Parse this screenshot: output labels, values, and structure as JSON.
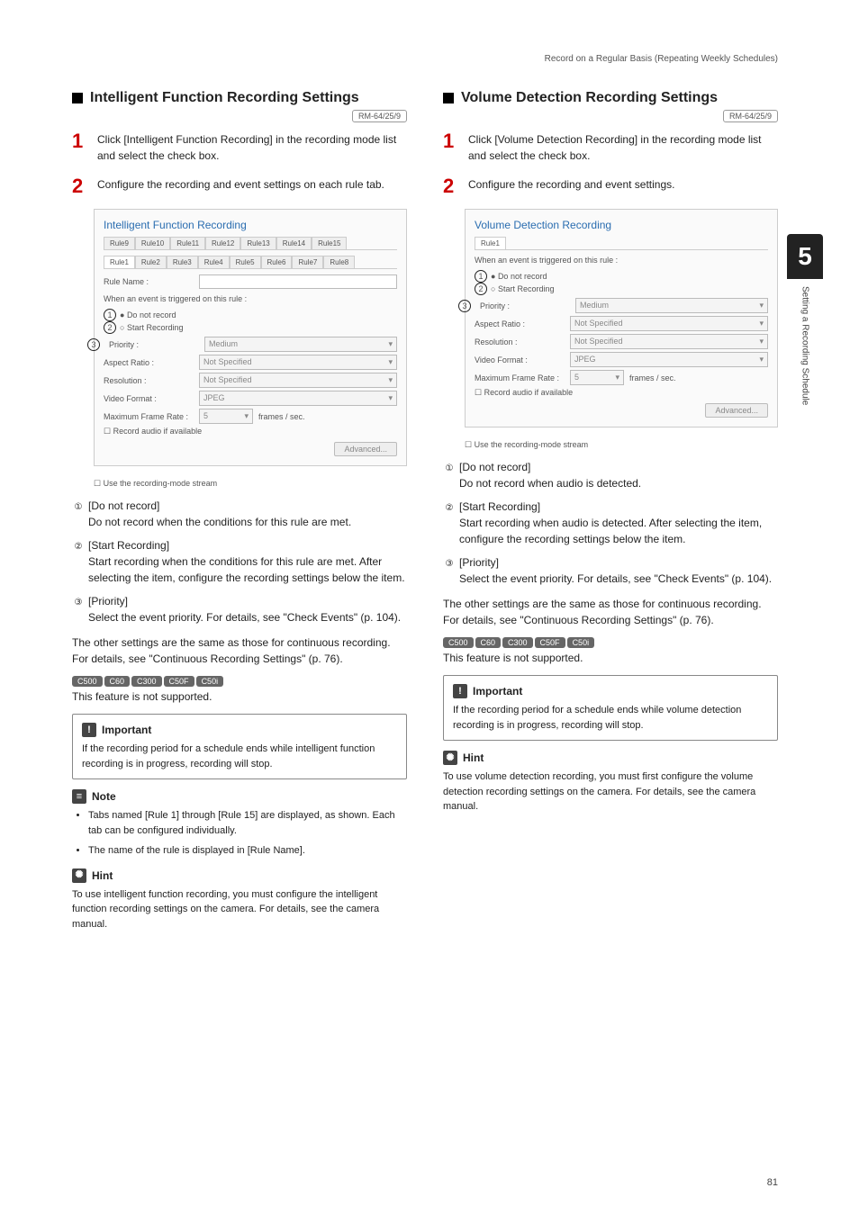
{
  "header": {
    "breadcrumb": "Record on a Regular Basis (Repeating Weekly Schedules)"
  },
  "side": {
    "chapter_num": "5",
    "chapter_title": "Setting a Recording Schedule"
  },
  "left": {
    "heading": "Intelligent Function Recording Settings",
    "badge": "RM-64/25/9",
    "step1": "Click [Intelligent Function Recording] in the recording mode list and select the check box.",
    "step2": "Configure the recording and event settings on each rule tab.",
    "shot": {
      "title": "Intelligent Function Recording",
      "tabs_top": [
        "Rule9",
        "Rule10",
        "Rule11",
        "Rule12",
        "Rule13",
        "Rule14",
        "Rule15"
      ],
      "tabs_bottom": [
        "Rule1",
        "Rule2",
        "Rule3",
        "Rule4",
        "Rule5",
        "Rule6",
        "Rule7",
        "Rule8"
      ],
      "rule_name_label": "Rule Name :",
      "trigger_label": "When an event is triggered on this rule :",
      "opt1": "Do not record",
      "opt2": "Start Recording",
      "priority_label": "Priority :",
      "priority_val": "Medium",
      "aspect_label": "Aspect Ratio :",
      "aspect_val": "Not Specified",
      "res_label": "Resolution :",
      "res_val": "Not Specified",
      "vf_label": "Video Format :",
      "vf_val": "JPEG",
      "mfr_label": "Maximum Frame Rate :",
      "mfr_val": "5",
      "mfr_unit": "frames / sec.",
      "audio_check": "Record audio if available",
      "advanced": "Advanced...",
      "stream_check": "Use the recording-mode stream"
    },
    "list": {
      "i1_t": "[Do not record]",
      "i1_b": "Do not record when the conditions for this rule are met.",
      "i2_t": "[Start Recording]",
      "i2_b": "Start recording when the conditions for this rule are met. After selecting the item, configure the recording settings below the item.",
      "i3_t": "[Priority]",
      "i3_b": "Select the event priority. For details, see \"Check Events\" (p. 104)."
    },
    "other_para": "The other settings are the same as those for continuous recording. For details, see \"Continuous Recording Settings\" (p. 76).",
    "models": [
      "C500",
      "C60",
      "C300",
      "C50F",
      "C50i"
    ],
    "not_supported": "This feature is not supported.",
    "important_head": "Important",
    "important_body": "If the recording period for a schedule ends while intelligent function recording is in progress, recording will stop.",
    "note_head": "Note",
    "note_b1": "Tabs named [Rule 1] through [Rule 15] are displayed, as shown. Each tab can be configured individually.",
    "note_b2": "The name of the rule is displayed in [Rule Name].",
    "hint_head": "Hint",
    "hint_body": "To use intelligent function recording, you must configure the intelligent function recording settings on the camera. For details, see the camera manual."
  },
  "right": {
    "heading": "Volume Detection Recording Settings",
    "badge": "RM-64/25/9",
    "step1": "Click [Volume Detection Recording] in the recording mode list and select the check box.",
    "step2": "Configure the recording and event settings.",
    "shot": {
      "title": "Volume Detection Recording",
      "tab": "Rule1",
      "trigger_label": "When an event is triggered on this rule :",
      "opt1": "Do not record",
      "opt2": "Start Recording",
      "priority_label": "Priority :",
      "priority_val": "Medium",
      "aspect_label": "Aspect Ratio :",
      "aspect_val": "Not Specified",
      "res_label": "Resolution :",
      "res_val": "Not Specified",
      "vf_label": "Video Format :",
      "vf_val": "JPEG",
      "mfr_label": "Maximum Frame Rate :",
      "mfr_val": "5",
      "mfr_unit": "frames / sec.",
      "audio_check": "Record audio if available",
      "advanced": "Advanced...",
      "stream_check": "Use the recording-mode stream"
    },
    "list": {
      "i1_t": "[Do not record]",
      "i1_b": "Do not record when audio is detected.",
      "i2_t": "[Start Recording]",
      "i2_b": "Start recording when audio is detected. After selecting the item, configure the recording settings below the item.",
      "i3_t": "[Priority]",
      "i3_b": "Select the event priority. For details, see \"Check Events\" (p. 104)."
    },
    "other_para": "The other settings are the same as those for continuous recording. For details, see \"Continuous Recording Settings\" (p. 76).",
    "models": [
      "C500",
      "C60",
      "C300",
      "C50F",
      "C50i"
    ],
    "not_supported": "This feature is not supported.",
    "important_head": "Important",
    "important_body": "If the recording period for a schedule ends while volume detection recording is in progress, recording will stop.",
    "hint_head": "Hint",
    "hint_body": "To use volume detection recording, you must first configure the volume detection recording settings on the camera. For details, see the camera manual."
  },
  "page_number": "81"
}
